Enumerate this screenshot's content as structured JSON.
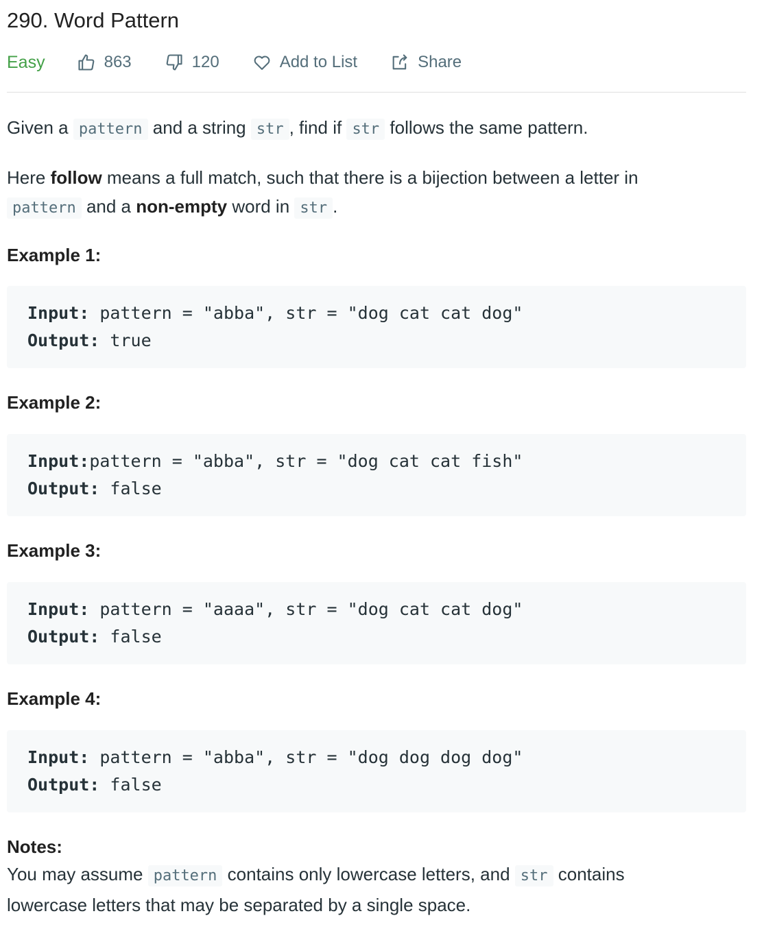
{
  "problem": {
    "title": "290. Word Pattern",
    "difficulty": "Easy",
    "likes": "863",
    "dislikes": "120",
    "add_to_list": "Add to List",
    "share": "Share"
  },
  "description": {
    "p1": {
      "t1": "Given a ",
      "c1": "pattern",
      "t2": " and a string ",
      "c2": "str",
      "t3": ", find if ",
      "c3": "str",
      "t4": " follows the same pattern."
    },
    "p2": {
      "t1": "Here ",
      "b1": "follow",
      "t2": " means a full match, such that there is a bijection between a letter in",
      "c1": "pattern",
      "t3": " and a ",
      "b2": "non-empty",
      "t4": " word in ",
      "c2": "str",
      "t5": "."
    }
  },
  "examples": [
    {
      "title": "Example 1:",
      "input_label": "Input:",
      "input": " pattern = \"abba\", str = \"dog cat cat dog\"",
      "output_label": "Output:",
      "output": " true"
    },
    {
      "title": "Example 2:",
      "input_label": "Input:",
      "input": "pattern = \"abba\", str = \"dog cat cat fish\"",
      "output_label": "Output:",
      "output": " false"
    },
    {
      "title": "Example 3:",
      "input_label": "Input:",
      "input": " pattern = \"aaaa\", str = \"dog cat cat dog\"",
      "output_label": "Output:",
      "output": " false"
    },
    {
      "title": "Example 4:",
      "input_label": "Input:",
      "input": " pattern = \"abba\", str = \"dog dog dog dog\"",
      "output_label": "Output:",
      "output": " false"
    }
  ],
  "notes": {
    "title": "Notes:",
    "t1": "You may assume ",
    "c1": "pattern",
    "t2": " contains only lowercase letters, and ",
    "c2": "str",
    "t3": " contains",
    "t4": "lowercase letters that may be separated by a single space."
  },
  "icons": {
    "like": "thumbs-up-icon",
    "dislike": "thumbs-down-icon",
    "list": "heart-icon",
    "share": "share-icon"
  },
  "colors": {
    "easy": "#43a047",
    "meta_text": "#546e7a",
    "code_bg": "#f7f9fa"
  }
}
